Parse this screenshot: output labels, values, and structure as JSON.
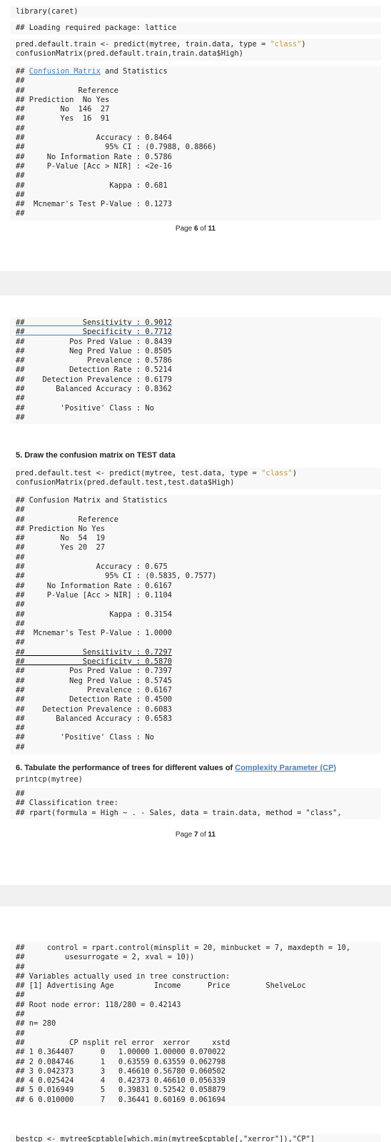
{
  "page1": {
    "code_lib": "library(caret)",
    "msg_lattice": "## Loading required package: lattice",
    "code_pred_train_a": "pred.default.train <- predict(mytree, train.data, type = ",
    "code_pred_train_str": "\"class\"",
    "code_pred_train_b": ")",
    "code_cm_train": "confusionMatrix(pred.default.train,train.data$High)",
    "cm_title_prefix": "## ",
    "cm_title_link": "Confusion Matrix",
    "cm_title_suffix": " and Statistics",
    "out_lines": [
      "##",
      "##            Reference",
      "## Prediction  No Yes",
      "##        No  146  27",
      "##        Yes  16  91",
      "##",
      "##                Accuracy : 0.8464",
      "##                  95% CI : (0.7988, 0.8866)",
      "##     No Information Rate : 0.5786",
      "##     P-Value [Acc > NIR] : <2e-16",
      "##",
      "##                   Kappa : 0.681",
      "##",
      "##  Mcnemar's Test P-Value : 0.1273",
      "##"
    ],
    "footer_prefix": "Page ",
    "footer_page": "6",
    "footer_of": " of ",
    "footer_total": "11"
  },
  "page2": {
    "sens_spec": [
      "##             Sensitivity : 0.9012",
      "##             Specificity : 0.7712"
    ],
    "out_lines": [
      "##          Pos Pred Value : 0.8439",
      "##          Neg Pred Value : 0.8505",
      "##              Prevalence : 0.5786",
      "##          Detection Rate : 0.5214",
      "##    Detection Prevalence : 0.6179",
      "##       Balanced Accuracy : 0.8362",
      "##",
      "##        'Positive' Class : No",
      "##"
    ],
    "heading5": "5. Draw the confusion matrix on TEST data",
    "code_pred_test_a": "pred.default.test <- predict(mytree, test.data, type = ",
    "code_pred_test_str": "\"class\"",
    "code_pred_test_b": ")",
    "code_cm_test": "confusionMatrix(pred.default.test,test.data$High)",
    "test_lines": [
      "## Confusion Matrix and Statistics",
      "##",
      "##            Reference",
      "## Prediction No Yes",
      "##        No  54  19",
      "##        Yes 20  27",
      "##",
      "##                Accuracy : 0.675",
      "##                  95% CI : (0.5835, 0.7577)",
      "##     No Information Rate : 0.6167",
      "##     P-Value [Acc > NIR] : 0.1104",
      "##",
      "##                   Kappa : 0.3154",
      "##",
      "##  Mcnemar's Test P-Value : 1.0000",
      "##"
    ],
    "test_sens_spec": [
      "##             Sensitivity : 0.7297",
      "##             Specificity : 0.5870"
    ],
    "test_lines2": [
      "##          Pos Pred Value : 0.7397",
      "##          Neg Pred Value : 0.5745",
      "##              Prevalence : 0.6167",
      "##          Detection Rate : 0.4500",
      "##    Detection Prevalence : 0.6083",
      "##       Balanced Accuracy : 0.6583",
      "##",
      "##        'Positive' Class : No",
      "##"
    ],
    "heading6_prefix": "6. Tabulate the performance of trees for different values of ",
    "heading6_link": "Complexity Parameter (CP)",
    "code_printcp": "printcp(mytree)",
    "cp_lines": [
      "##",
      "## Classification tree:",
      "## rpart(formula = High ~ . - Sales, data = train.data, method = \"class\","
    ],
    "footer_prefix": "Page ",
    "footer_page": "7",
    "footer_of": " of ",
    "footer_total": "11"
  },
  "page3": {
    "lines": [
      "##     control = rpart.control(minsplit = 20, minbucket = 7, maxdepth = 10,",
      "##         usesurrogate = 2, xval = 10))",
      "##",
      "## Variables actually used in tree construction:",
      "## [1] Advertising Age         Income      Price        ShelveLoc",
      "##",
      "## Root node error: 118/280 = 0.42143",
      "##",
      "## n= 280",
      "##",
      "##          CP nsplit rel error  xerror     xstd",
      "## 1 0.364407      0   1.00000 1.00000 0.070022",
      "## 2 0.084746      1   0.63559 0.63559 0.062798",
      "## 3 0.042373      3   0.46610 0.56780 0.060502",
      "## 4 0.025424      4   0.42373 0.46610 0.056339",
      "## 5 0.016949      5   0.39831 0.52542 0.058879",
      "## 6 0.010000      7   0.36441 0.60169 0.061694"
    ],
    "cut_line": "bestcp <- mytree$cptable[which.min(mytree$cptable[,\"xerror\"]),\"CP\"]"
  }
}
